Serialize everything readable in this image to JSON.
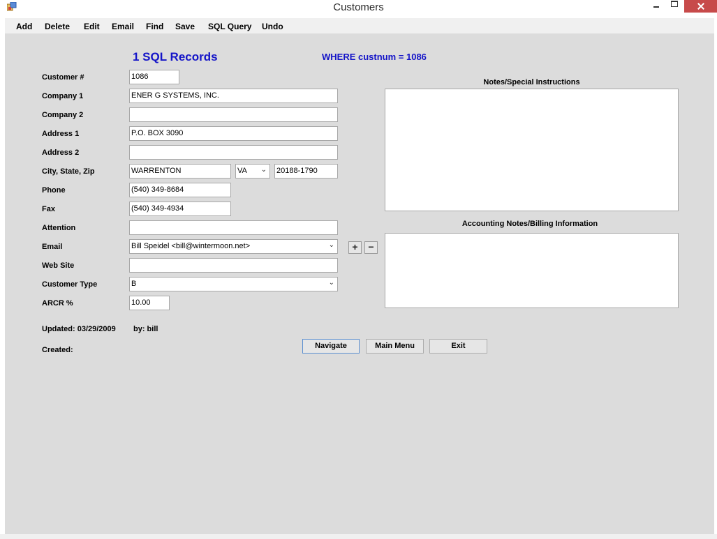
{
  "window": {
    "title": "Customers",
    "icon": "app-form-icon"
  },
  "menu": [
    "Add",
    "Delete",
    "Edit",
    "Email",
    "Find",
    "Save",
    "SQL Query",
    "Undo"
  ],
  "header": {
    "records": "1 SQL Records",
    "where": "WHERE custnum = 1086"
  },
  "labels": {
    "customer_num": "Customer #",
    "company1": "Company 1",
    "company2": "Company 2",
    "address1": "Address 1",
    "address2": "Address 2",
    "city_state_zip": "City, State, Zip",
    "phone": "Phone",
    "fax": "Fax",
    "attention": "Attention",
    "email": "Email",
    "website": "Web Site",
    "customer_type": "Customer Type",
    "arcr": "ARCR %"
  },
  "fields": {
    "customer_num": "1086",
    "company1": "ENER G SYSTEMS, INC.",
    "company2": "",
    "address1": "P.O. BOX 3090",
    "address2": "",
    "city": "WARRENTON",
    "state": "VA",
    "zip": "20188-1790",
    "phone": "(540) 349-8684",
    "fax": "(540) 349-4934",
    "attention": "",
    "email": "Bill Speidel <bill@wintermoon.net>",
    "website": "",
    "customer_type": "B",
    "arcr": "10.00"
  },
  "notes": {
    "special_label": "Notes/Special Instructions",
    "accounting_label": "Accounting Notes/Billing Information"
  },
  "footer": {
    "updated": "Updated: 03/29/2009",
    "by": "by: bill",
    "created": "Created:"
  },
  "buttons": {
    "add": "+",
    "remove": "−",
    "navigate": "Navigate",
    "main_menu": "Main Menu",
    "exit": "Exit"
  }
}
